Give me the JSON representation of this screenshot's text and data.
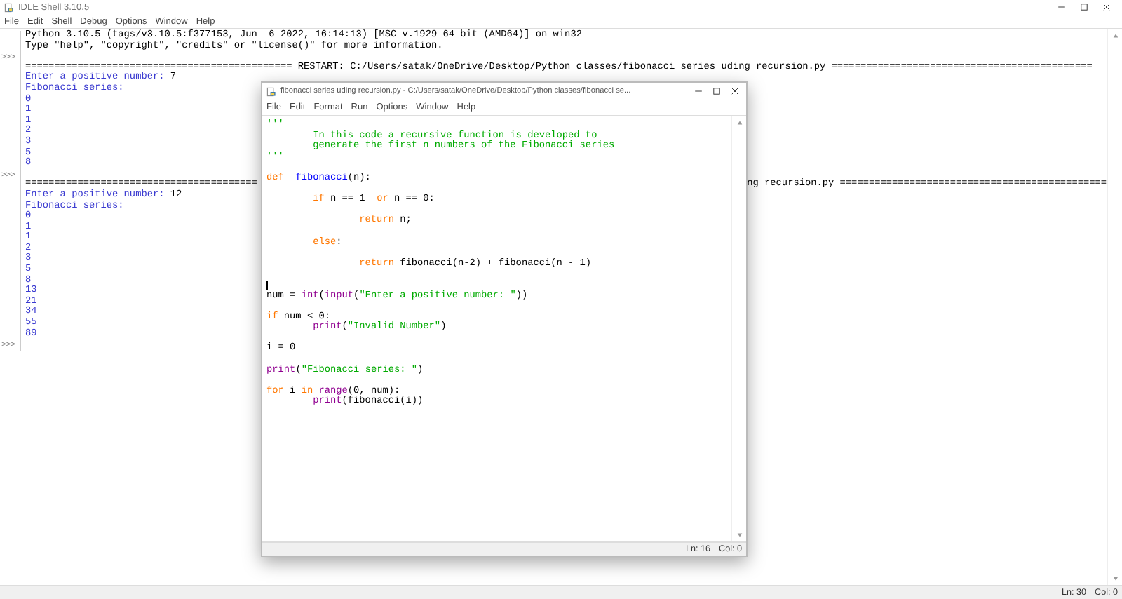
{
  "shell": {
    "title": "IDLE Shell 3.10.5",
    "menu": [
      "File",
      "Edit",
      "Shell",
      "Debug",
      "Options",
      "Window",
      "Help"
    ],
    "lines": [
      {
        "kind": "info",
        "text": "Python 3.10.5 (tags/v3.10.5:f377153, Jun  6 2022, 16:14:13) [MSC v.1929 64 bit (AMD64)] on win32"
      },
      {
        "kind": "info",
        "text": "Type \"help\", \"copyright\", \"credits\" or \"license()\" for more information."
      },
      {
        "kind": "info",
        "prompt": ">>>"
      },
      {
        "kind": "info",
        "text": "============================================== RESTART: C:/Users/satak/OneDrive/Desktop/Python classes/fibonacci series uding recursion.py ============================================="
      },
      {
        "kind": "stdout",
        "text": "Enter a positive number: ",
        "input": "7"
      },
      {
        "kind": "stdout",
        "text": "Fibonacci series:"
      },
      {
        "kind": "stdout",
        "text": "0"
      },
      {
        "kind": "stdout",
        "text": "1"
      },
      {
        "kind": "stdout",
        "text": "1"
      },
      {
        "kind": "stdout",
        "text": "2"
      },
      {
        "kind": "stdout",
        "text": "3"
      },
      {
        "kind": "stdout",
        "text": "5"
      },
      {
        "kind": "stdout",
        "text": "8"
      },
      {
        "kind": "info",
        "prompt": ">>>"
      },
      {
        "kind": "split",
        "text": "========================================",
        "right": "ng recursion.py =============================================="
      },
      {
        "kind": "stdout",
        "text": "Enter a positive number: ",
        "input": "12"
      },
      {
        "kind": "stdout",
        "text": "Fibonacci series:"
      },
      {
        "kind": "stdout",
        "text": "0"
      },
      {
        "kind": "stdout",
        "text": "1"
      },
      {
        "kind": "stdout",
        "text": "1"
      },
      {
        "kind": "stdout",
        "text": "2"
      },
      {
        "kind": "stdout",
        "text": "3"
      },
      {
        "kind": "stdout",
        "text": "5"
      },
      {
        "kind": "stdout",
        "text": "8"
      },
      {
        "kind": "stdout",
        "text": "13"
      },
      {
        "kind": "stdout",
        "text": "21"
      },
      {
        "kind": "stdout",
        "text": "34"
      },
      {
        "kind": "stdout",
        "text": "55"
      },
      {
        "kind": "stdout",
        "text": "89"
      },
      {
        "kind": "info",
        "prompt": ">>>"
      }
    ],
    "status": {
      "line": "Ln: 30",
      "col": "Col: 0"
    }
  },
  "editor": {
    "title": "fibonacci series uding recursion.py - C:/Users/satak/OneDrive/Desktop/Python classes/fibonacci se...",
    "menu": [
      "File",
      "Edit",
      "Format",
      "Run",
      "Options",
      "Window",
      "Help"
    ],
    "lines": [
      {
        "tokens": [
          {
            "kind": "string",
            "text": "'''"
          }
        ]
      },
      {
        "tokens": [
          {
            "kind": "string",
            "text": "        In this code a recursive function is developed to"
          }
        ]
      },
      {
        "tokens": [
          {
            "kind": "string",
            "text": "        generate the first n numbers of the Fibonacci series"
          }
        ]
      },
      {
        "tokens": [
          {
            "kind": "string",
            "text": "'''"
          }
        ]
      },
      {
        "blank_before": true,
        "tokens": [
          {
            "kind": "keyword",
            "text": "def  "
          },
          {
            "kind": "definition",
            "text": "fibonacci"
          },
          {
            "kind": "plain",
            "text": "(n):"
          }
        ]
      },
      {
        "blank_before": true,
        "kind": "indented",
        "tokens": [
          {
            "kind": "keyword",
            "text": "if"
          },
          {
            "kind": "plain",
            "text": " n == 1  "
          },
          {
            "kind": "keyword",
            "text": "or"
          },
          {
            "kind": "plain",
            "text": " n == 0:"
          }
        ]
      },
      {
        "blank_before": true,
        "kind": "double_indented",
        "tokens": [
          {
            "kind": "keyword",
            "text": "return"
          },
          {
            "kind": "plain",
            "text": " n;"
          }
        ]
      },
      {
        "blank_before": true,
        "kind": "indented",
        "tokens": [
          {
            "kind": "keyword",
            "text": "else"
          },
          {
            "kind": "plain",
            "text": ":"
          }
        ]
      },
      {
        "blank_before": true,
        "kind": "double_indented",
        "tokens": [
          {
            "kind": "keyword",
            "text": "return"
          },
          {
            "kind": "plain",
            "text": " fibonacci(n-2) + fibonacci(n - 1)"
          }
        ]
      },
      {
        "blank_before": true,
        "caret": true
      },
      {
        "tokens": [
          {
            "kind": "plain",
            "text": "num = "
          },
          {
            "kind": "builtin",
            "text": "int"
          },
          {
            "kind": "plain",
            "text": "("
          },
          {
            "kind": "builtin",
            "text": "input"
          },
          {
            "kind": "plain",
            "text": "("
          },
          {
            "kind": "string",
            "text": "\"Enter a positive number: \""
          },
          {
            "kind": "plain",
            "text": "))"
          }
        ]
      },
      {
        "blank_before": true,
        "tokens": [
          {
            "kind": "keyword",
            "text": "if"
          },
          {
            "kind": "plain",
            "text": " num < 0:"
          }
        ]
      },
      {
        "kind": "indented",
        "tokens": [
          {
            "kind": "builtin",
            "text": "print"
          },
          {
            "kind": "plain",
            "text": "("
          },
          {
            "kind": "string",
            "text": "\"Invalid Number\""
          },
          {
            "kind": "plain",
            "text": ")"
          }
        ]
      },
      {
        "blank_before": true,
        "tokens": [
          {
            "kind": "plain",
            "text": "i = 0"
          }
        ]
      },
      {
        "blank_before": true,
        "tokens": [
          {
            "kind": "builtin",
            "text": "print"
          },
          {
            "kind": "plain",
            "text": "("
          },
          {
            "kind": "string",
            "text": "\"Fibonacci series: \""
          },
          {
            "kind": "plain",
            "text": ")"
          }
        ]
      },
      {
        "blank_before": true,
        "tokens": [
          {
            "kind": "keyword",
            "text": "for"
          },
          {
            "kind": "plain",
            "text": " i "
          },
          {
            "kind": "keyword",
            "text": "in "
          },
          {
            "kind": "builtin",
            "text": "range"
          },
          {
            "kind": "plain",
            "text": "(0, num):"
          }
        ]
      },
      {
        "kind": "indented",
        "tokens": [
          {
            "kind": "builtin",
            "text": "print"
          },
          {
            "kind": "plain",
            "text": "(fibonacci(i))"
          }
        ]
      }
    ],
    "status": {
      "line": "Ln: 16",
      "col": "Col: 0"
    }
  }
}
